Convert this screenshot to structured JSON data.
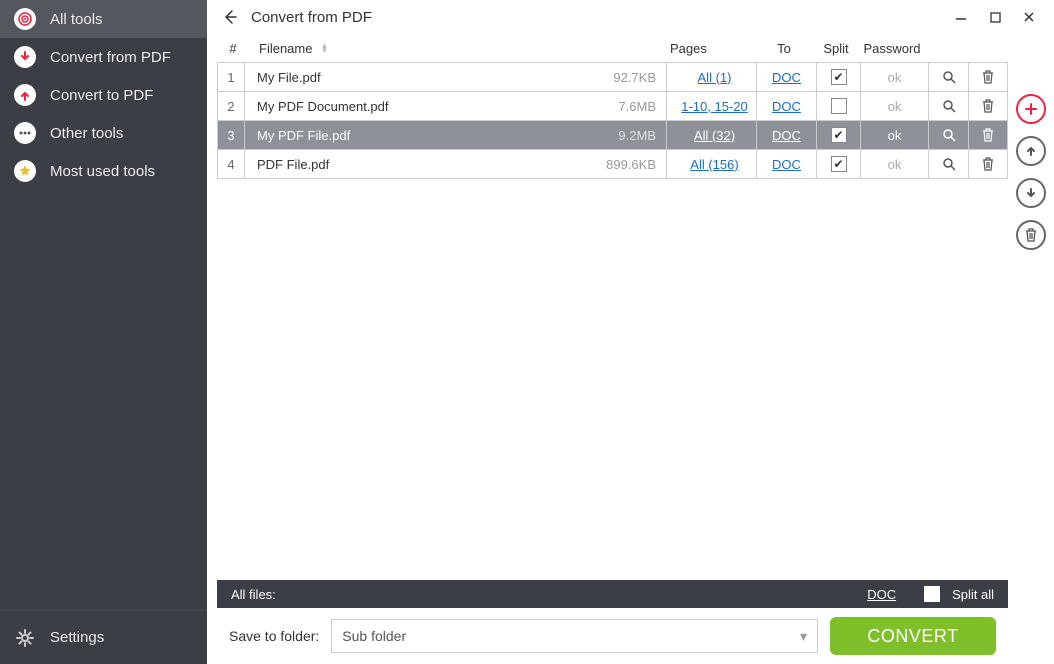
{
  "sidebar": {
    "items": [
      {
        "label": "All tools"
      },
      {
        "label": "Convert from PDF"
      },
      {
        "label": "Convert to PDF"
      },
      {
        "label": "Other tools"
      },
      {
        "label": "Most used tools"
      }
    ],
    "settings_label": "Settings"
  },
  "header": {
    "title": "Convert from PDF"
  },
  "columns": {
    "num": "#",
    "filename": "Filename",
    "pages": "Pages",
    "to": "To",
    "split": "Split",
    "password": "Password"
  },
  "rows": [
    {
      "n": "1",
      "name": "My File.pdf",
      "size": "92.7KB",
      "pages": "All (1)",
      "to": "DOC",
      "split": true,
      "pwd": "ok",
      "sel": false
    },
    {
      "n": "2",
      "name": "My PDF Document.pdf",
      "size": "7.6MB",
      "pages": "1-10, 15-20",
      "to": "DOC",
      "split": false,
      "pwd": "ok",
      "sel": false
    },
    {
      "n": "3",
      "name": "My PDF File.pdf",
      "size": "9.2MB",
      "pages": "All (32)",
      "to": "DOC",
      "split": true,
      "pwd": "ok",
      "sel": true
    },
    {
      "n": "4",
      "name": "PDF File.pdf",
      "size": "899.6KB",
      "pages": "All (156)",
      "to": "DOC",
      "split": true,
      "pwd": "ok",
      "sel": false
    }
  ],
  "allbar": {
    "label": "All files:",
    "to": "DOC",
    "split_all": "Split all"
  },
  "bottom": {
    "save_label": "Save to folder:",
    "folder": "Sub folder",
    "convert": "CONVERT"
  }
}
